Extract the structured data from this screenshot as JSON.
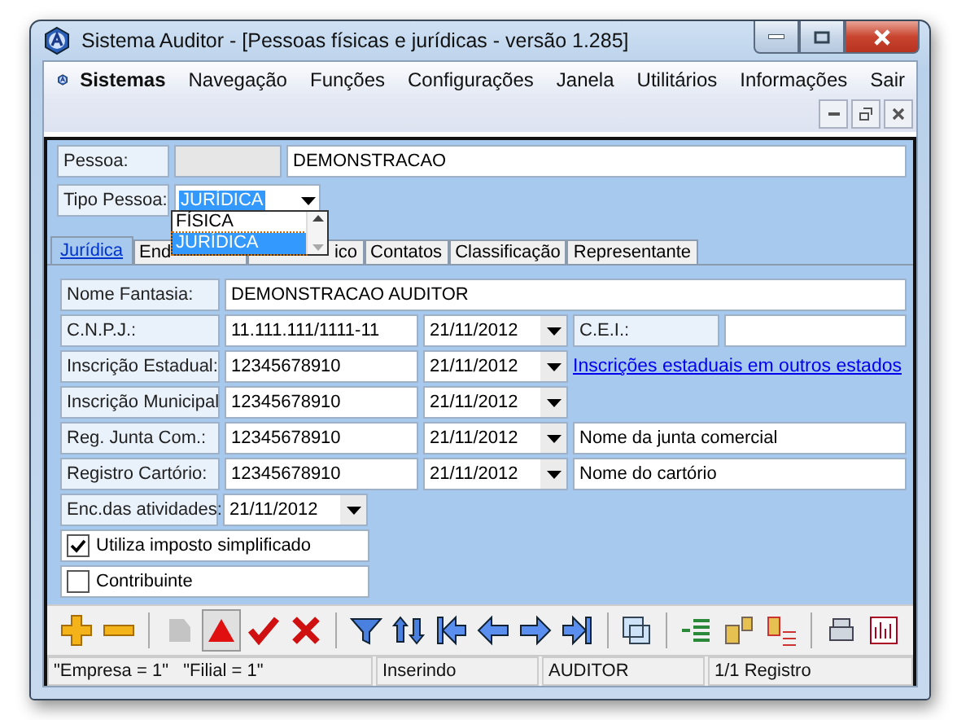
{
  "window": {
    "title": "Sistema Auditor - [Pessoas físicas e jurídicas - versão 1.285]"
  },
  "menu": [
    {
      "label": "Sistemas",
      "bold": true
    },
    {
      "label": "Navegação",
      "bold": false
    },
    {
      "label": "Funções",
      "bold": false
    },
    {
      "label": "Configurações",
      "bold": false
    },
    {
      "label": "Janela",
      "bold": false
    },
    {
      "label": "Utilitários",
      "bold": false
    },
    {
      "label": "Informações",
      "bold": false
    },
    {
      "label": "Sair",
      "bold": false
    }
  ],
  "header": {
    "pessoa_label": "Pessoa:",
    "pessoa_name": "DEMONSTRACAO",
    "tipo_label": "Tipo Pessoa:",
    "tipo_value": "JURÍDICA",
    "dropdown": [
      {
        "label": "FÍSICA",
        "selected": false
      },
      {
        "label": "JURÍDICA",
        "selected": true
      }
    ]
  },
  "tabs": [
    {
      "label": "Jurídica",
      "selected": true
    },
    {
      "label": "End",
      "selected": false
    },
    {
      "label": "ico",
      "selected": false
    },
    {
      "label": "Contatos",
      "selected": false
    },
    {
      "label": "Classificação",
      "selected": false
    },
    {
      "label": "Representante",
      "selected": false
    }
  ],
  "rows": [
    {
      "kind": "text",
      "label": "Nome Fantasia:",
      "value": "DEMONSTRACAO AUDITOR"
    },
    {
      "kind": "extra-field",
      "label": "C.N.P.J.:",
      "value": "11.111.111/1111-11",
      "date": "21/11/2012",
      "extra_label": "C.E.I.:"
    },
    {
      "kind": "link",
      "label": "Inscrição Estadual:",
      "value": "12345678910",
      "date": "21/11/2012",
      "link": "Inscrições estaduais em outros estados"
    },
    {
      "kind": "date",
      "label": "Inscrição Municipal",
      "value": "12345678910",
      "date": "21/11/2012"
    },
    {
      "kind": "note",
      "label": "Reg. Junta Com.:",
      "value": "12345678910",
      "date": "21/11/2012",
      "note": "Nome da junta comercial"
    },
    {
      "kind": "note",
      "label": "Registro Cartório:",
      "value": "12345678910",
      "date": "21/11/2012",
      "note": "Nome do cartório"
    },
    {
      "kind": "date-only",
      "label": "Enc.das atividades:",
      "date": "21/11/2012"
    }
  ],
  "checkboxes": [
    {
      "label": "Utiliza imposto simplificado",
      "checked": true
    },
    {
      "label": "Contribuinte",
      "checked": false
    }
  ],
  "toolbar": [
    [
      {
        "disabled": false,
        "pressed": false
      },
      {
        "disabled": false,
        "pressed": false
      }
    ],
    [
      {
        "disabled": true,
        "pressed": false
      },
      {
        "disabled": false,
        "pressed": true
      },
      {
        "disabled": false,
        "pressed": false
      },
      {
        "disabled": false,
        "pressed": false
      }
    ],
    [
      {
        "disabled": false,
        "pressed": false
      },
      {
        "disabled": false,
        "pressed": false
      },
      {
        "disabled": false,
        "pressed": false
      },
      {
        "disabled": false,
        "pressed": false
      },
      {
        "disabled": false,
        "pressed": false
      },
      {
        "disabled": false,
        "pressed": false
      }
    ],
    [
      {
        "disabled": false,
        "pressed": false
      }
    ],
    [
      {
        "disabled": false,
        "pressed": false
      },
      {
        "disabled": false,
        "pressed": false
      },
      {
        "disabled": false,
        "pressed": false
      }
    ],
    [
      {
        "disabled": false,
        "pressed": false
      },
      {
        "disabled": false,
        "pressed": false
      }
    ]
  ],
  "status_bar": [
    "\"Empresa = 1\"   \"Filial = 1\"",
    "Inserindo",
    "AUDITOR",
    "1/1 Registro"
  ]
}
